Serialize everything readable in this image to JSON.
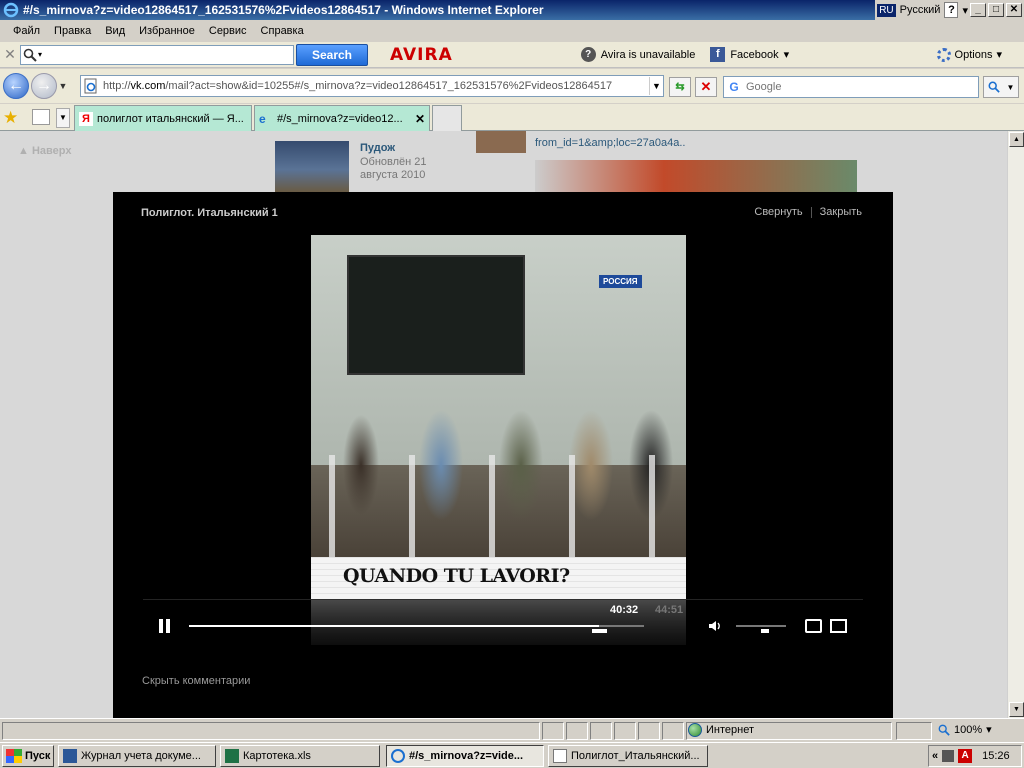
{
  "window": {
    "title": "#/s_mirnova?z=video12864517_162531576%2Fvideos12864517 - Windows Internet Explorer",
    "lang_code": "RU",
    "lang_name": "Русский",
    "help_label": "?",
    "controls": {
      "minimize": "_",
      "maximize": "□",
      "close": "✕"
    }
  },
  "menu": [
    "Файл",
    "Правка",
    "Вид",
    "Избранное",
    "Сервис",
    "Справка"
  ],
  "avira_toolbar": {
    "search_placeholder": "",
    "search_button": "Search",
    "logo": "AVIRA",
    "status": "Avira is unavailable",
    "facebook": "Facebook",
    "options": "Options"
  },
  "address_bar": {
    "url_prefix": "http://",
    "url_host": "vk.com",
    "url_rest": "/mail?act=show&id=10255#/s_mirnova?z=video12864517_162531576%2Fvideos12864517",
    "search_placeholder": "Google"
  },
  "tabs": [
    {
      "label": "полиглот итальянский — Я...",
      "favicon": "Я"
    },
    {
      "label": "#/s_mirnova?z=video12...",
      "close": "✕"
    },
    {
      "label": ""
    }
  ],
  "page": {
    "back_to_top": "▲ Наверх",
    "item_title": "Пудож",
    "item_updated": "Обновлён 21 августа 2010",
    "link_text": "from_id=1&amp;loc=27a0a4a.."
  },
  "video": {
    "title": "Полиглот. Итальянский 1",
    "minimize_label": "Свернуть",
    "close_label": "Закрыть",
    "frame_logo": "РОССИЯ",
    "frame_caption": "QUANDO TU LAVORI?",
    "time_current": "40:32",
    "time_total": "44:51",
    "progress_fraction": 0.9,
    "volume_fraction": 0.58,
    "hide_comments": "Скрыть комментарии"
  },
  "status_bar": {
    "zone": "Интернет",
    "zoom": "100%"
  },
  "taskbar": {
    "start": "Пуск",
    "tasks": [
      {
        "label": "Журнал учета докуме...",
        "icon": "word-icon"
      },
      {
        "label": "Картотека.xls",
        "icon": "excel-icon"
      },
      {
        "label": "#/s_mirnova?z=vide...",
        "icon": "ie-icon",
        "active": true
      },
      {
        "label": "Полиглот_Итальянский...",
        "icon": "doc-icon"
      }
    ],
    "tray_arrows": "«",
    "clock": "15:26"
  }
}
